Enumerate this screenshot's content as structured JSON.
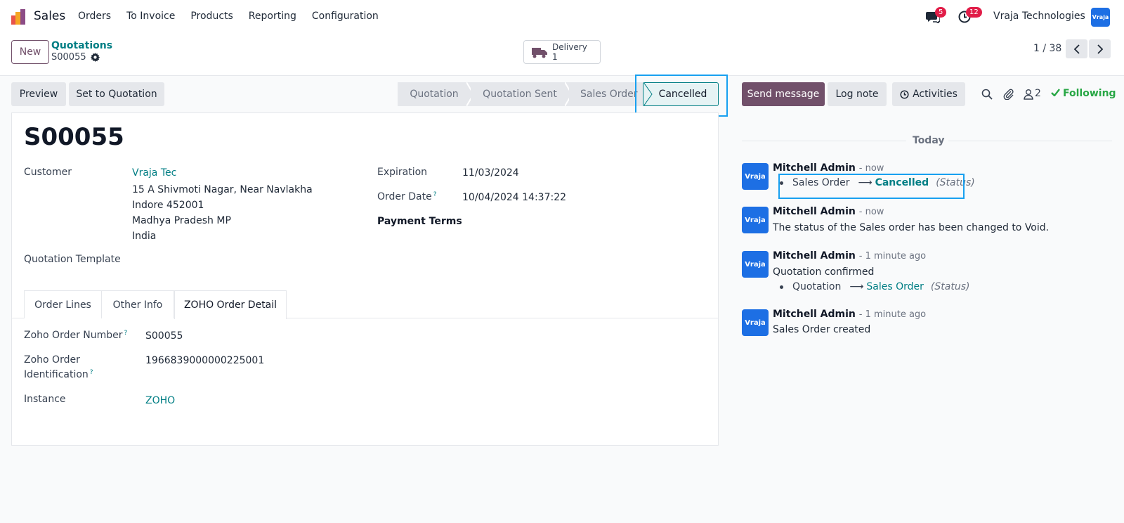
{
  "navbar": {
    "app_name": "Sales",
    "menu": [
      "Orders",
      "To Invoice",
      "Products",
      "Reporting",
      "Configuration"
    ],
    "messages_badge": "5",
    "activities_badge": "12",
    "company": "Vraja Technologies",
    "avatar_text": "Vraja"
  },
  "control": {
    "new_label": "New",
    "breadcrumb_parent": "Quotations",
    "breadcrumb_current": "S00055",
    "delivery_label": "Delivery",
    "delivery_count": "1",
    "pager": "1 / 38"
  },
  "actions": {
    "preview": "Preview",
    "set_to_quotation": "Set to Quotation"
  },
  "statusbar": {
    "stages": [
      "Quotation",
      "Quotation Sent",
      "Sales Order"
    ],
    "active": "Cancelled"
  },
  "form": {
    "title": "S00055",
    "customer_label": "Customer",
    "customer_name": "Vraja Tec",
    "address": [
      "15 A Shivmoti Nagar, Near Navlakha",
      "Indore 452001",
      "Madhya Pradesh MP",
      "India"
    ],
    "expiration_label": "Expiration",
    "expiration_value": "11/03/2024",
    "order_date_label": "Order Date",
    "order_date_value": "10/04/2024 14:37:22",
    "payment_terms_label": "Payment Terms",
    "quotation_template_label": "Quotation Template",
    "help_mark": "?",
    "tabs": [
      "Order Lines",
      "Other Info",
      "ZOHO Order Detail"
    ],
    "zoho_order_number_label": "Zoho Order Number",
    "zoho_order_number_value": "S00055",
    "zoho_identification_label_1": "Zoho Order",
    "zoho_identification_label_2": "Identification",
    "zoho_identification_value": "1966839000000225001",
    "instance_label": "Instance",
    "instance_value": "ZOHO"
  },
  "chatter": {
    "send_message": "Send message",
    "log_note": "Log note",
    "activities": "Activities",
    "follower_count": "2",
    "following": "Following",
    "day": "Today",
    "avatar_text": "Vraja",
    "messages": [
      {
        "author": "Mitchell Admin",
        "time": "- now",
        "old": "Sales Order",
        "new": "Cancelled",
        "field": "(Status)"
      },
      {
        "author": "Mitchell Admin",
        "time": "- now",
        "body": "The status of the Sales order has been changed to Void."
      },
      {
        "author": "Mitchell Admin",
        "time": "- 1 minute ago",
        "body": "Quotation confirmed",
        "old": "Quotation",
        "new": "Sales Order",
        "field": "(Status)"
      },
      {
        "author": "Mitchell Admin",
        "time": "- 1 minute ago",
        "body": "Sales Order created"
      }
    ]
  },
  "colors": {
    "brand": "#71506a",
    "link": "#017e84",
    "highlight": "#18a0f0",
    "badge": "#e11d48",
    "following": "#28a745"
  }
}
